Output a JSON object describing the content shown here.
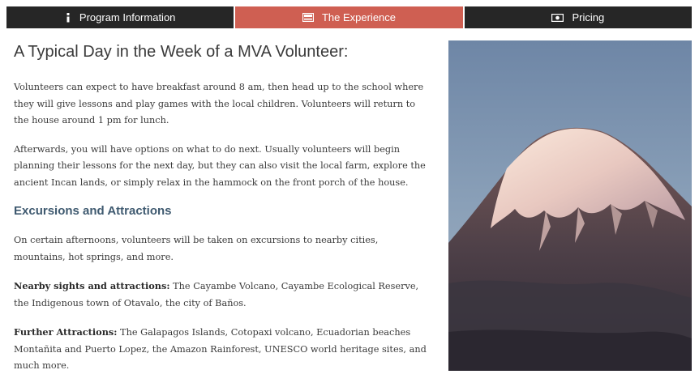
{
  "tabs": [
    {
      "label": "Program Information",
      "icon": "info-icon"
    },
    {
      "label": "The Experience",
      "icon": "film-icon",
      "active": true
    },
    {
      "label": "Pricing",
      "icon": "money-icon"
    }
  ],
  "main": {
    "title": "A Typical Day in the Week of a MVA Volunteer:",
    "para1": "Volunteers can expect to have breakfast around 8 am, then head up to the school where they will give lessons and play games with the local children. Volunteers will return to the house around 1 pm for lunch.",
    "para2": "Afterwards, you will have options on what to do next. Usually volunteers will begin planning their lessons for the next day, but they can also visit the local farm, explore the ancient Incan lands, or simply relax in the hammock on the front porch of the house.",
    "subheading": "Excursions and Attractions",
    "para3": "On certain afternoons, volunteers will be taken on excursions to nearby cities, mountains, hot springs, and more.",
    "nearby_label": "Nearby sights and attractions:",
    "nearby_text": " The Cayambe Volcano, Cayambe Ecological Reserve, the Indigenous town of Otavalo, the city of Baños.",
    "further_label": "Further Attractions:",
    "further_text": " The Galapagos Islands, Cotopaxi volcano, Ecuadorian beaches Montañita and Puerto Lopez, the Amazon Rainforest, UNESCO world heritage sites, and much more."
  },
  "photo": {
    "subject": "snow-capped volcano"
  },
  "colors": {
    "tab_dark": "#262626",
    "tab_active": "#cf5f52",
    "subheading": "#3f5a70"
  }
}
